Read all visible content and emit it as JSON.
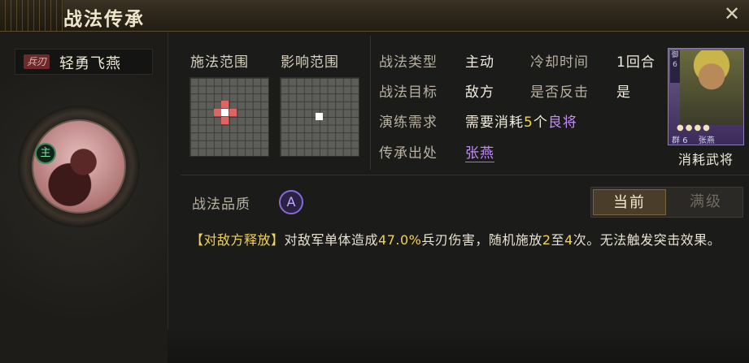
{
  "window": {
    "title": "战法传承",
    "close_symbol": "✕"
  },
  "skill": {
    "type_badge": "兵刃",
    "name": "轻勇飞燕",
    "main_badge": "主"
  },
  "ranges": {
    "cast_label": "施法范围",
    "effect_label": "影响范围"
  },
  "info": {
    "type_label": "战法类型",
    "type_value": "主动",
    "cooldown_label": "冷却时间",
    "cooldown_value": "1回合",
    "target_label": "战法目标",
    "target_value": "敌方",
    "counter_label": "是否反击",
    "counter_value": "是",
    "drill_label": "演练需求",
    "drill_value_pre": "需要消耗",
    "drill_value_num": "5",
    "drill_value_mid": "个",
    "drill_value_quality": "良将",
    "source_label": "传承出处",
    "source_value": "张燕"
  },
  "general_card": {
    "side_text": "御",
    "side_level": "6",
    "stars": "●●●●",
    "foot_left": "群",
    "foot_cost": "6",
    "foot_name": "张燕",
    "caption": "消耗武将"
  },
  "quality": {
    "label": "战法品质",
    "grade": "A"
  },
  "toggle": {
    "current": "当前",
    "max": "满级"
  },
  "description": {
    "tag": "【对敌方释放】",
    "part1": "对敌军单体造成",
    "percent": "47.0%",
    "part2": "兵刃伤害，随机施放",
    "min": "2",
    "part3": "至",
    "max": "4",
    "part4": "次。无法触发突击效果。"
  },
  "colors": {
    "accent_yellow": "#f1d25a",
    "accent_purple": "#c08ef5",
    "range_red": "#e06464"
  }
}
